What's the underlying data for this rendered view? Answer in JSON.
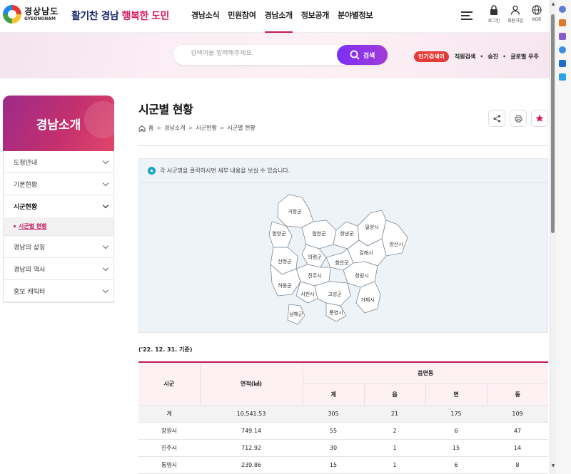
{
  "header": {
    "logo_ko": "경상남도",
    "logo_en": "GYEONGNAM",
    "slogan_a": "활기찬 경남",
    "slogan_b": "행복한 도민",
    "nav": [
      "경남소식",
      "민원참여",
      "경남소개",
      "정보공개",
      "분야별정보"
    ],
    "nav_active": "경남소개",
    "util": {
      "login": "로그인",
      "join": "회원가입",
      "lang": "KOR"
    }
  },
  "search": {
    "placeholder": "검색어를 입력해주세요.",
    "button": "검색",
    "popular_label": "인기검색어",
    "keywords": [
      "직원검색",
      "승진",
      "글로벌 우주"
    ]
  },
  "lnb": {
    "title": "경남소개",
    "items": [
      "도청안내",
      "기본현황",
      "시군현황",
      "경남의 상징",
      "경남의 역사",
      "홍보 캐릭터"
    ],
    "active_item": "시군현황",
    "sub_active": "시군별 현황"
  },
  "content": {
    "title": "시군별 현황",
    "breadcrumb": [
      "홈",
      "경남소개",
      "시군현황",
      "시군별 현황"
    ],
    "notice": "각 시군명을 클릭하시면 세부 내용을 보실 수 있습니다.",
    "base_date": "('22. 12. 31. 기준)"
  },
  "map": {
    "regions": [
      "거창군",
      "함양군",
      "합천군",
      "창녕군",
      "밀양시",
      "양산시",
      "산청군",
      "의령군",
      "함안군",
      "김해시",
      "창원시",
      "진주시",
      "하동군",
      "사천시",
      "고성군",
      "남해군",
      "통영시",
      "거제시"
    ]
  },
  "table": {
    "headers": {
      "sigun": "시군",
      "area": "면적(㎢)",
      "group": "읍면동",
      "total": "계",
      "eup": "읍",
      "myeon": "면",
      "dong": "동"
    },
    "rows": [
      {
        "name": "계",
        "area": "10,541.53",
        "total": "305",
        "eup": "21",
        "myeon": "175",
        "dong": "109"
      },
      {
        "name": "창원시",
        "area": "749.14",
        "total": "55",
        "eup": "2",
        "myeon": "6",
        "dong": "47"
      },
      {
        "name": "진주시",
        "area": "712.92",
        "total": "30",
        "eup": "1",
        "myeon": "15",
        "dong": "14"
      },
      {
        "name": "통영시",
        "area": "239.86",
        "total": "15",
        "eup": "1",
        "myeon": "6",
        "dong": "8"
      }
    ]
  },
  "colors": {
    "accent": "#c2185b",
    "search": "#7b2ff7",
    "badge": "#e53935"
  }
}
